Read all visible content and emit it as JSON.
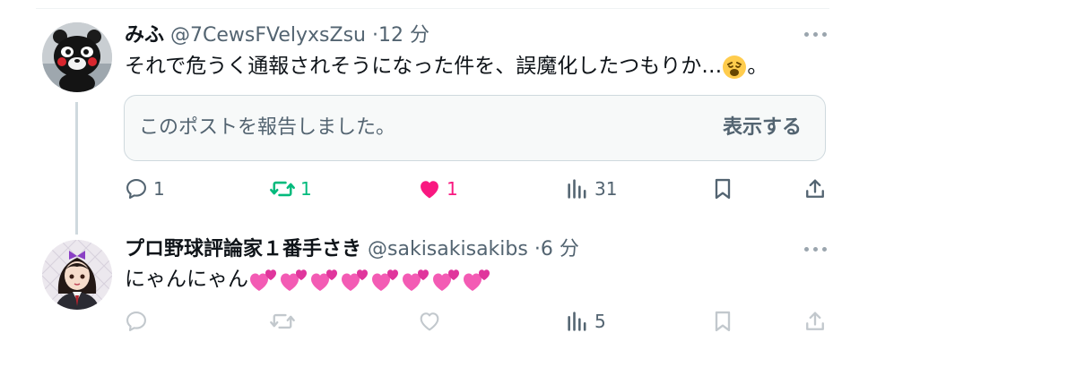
{
  "posts": [
    {
      "display_name": "みふ",
      "handle": "@7CewsFVelyxsZsu",
      "separator": "·",
      "time": "12 分",
      "text": "それで危うく通報されそうになった件を、誤魔化したつもりか…",
      "text_end": "。",
      "reported_notice": "このポストを報告しました。",
      "show_label": "表示する",
      "reply_count": "1",
      "repost_count": "1",
      "like_count": "1",
      "view_count": "31"
    },
    {
      "display_name": "プロ野球評論家１番手さき",
      "handle": "@sakisakisakibs",
      "separator": "·",
      "time": "6 分",
      "text": "にゃんにゃん",
      "hearts": 8,
      "view_count": "5"
    }
  ],
  "colors": {
    "repost_active": "#00ba7c",
    "like_active": "#f91880",
    "icon_gray": "#536471",
    "divider": "#eff3f4"
  },
  "icons": [
    "reply-icon",
    "repost-icon",
    "like-icon",
    "views-icon",
    "bookmark-icon",
    "share-icon",
    "more-icon"
  ]
}
